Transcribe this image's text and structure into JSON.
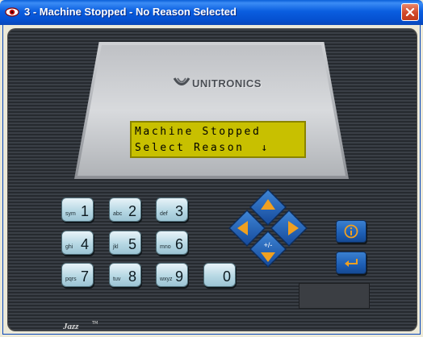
{
  "window": {
    "title": "3 - Machine Stopped - No Reason Selected",
    "icons": {
      "app": "eye-icon",
      "close": "close-icon"
    },
    "colors": {
      "titlebar": "#0a5ee0",
      "close_button": "#d0482a"
    }
  },
  "device": {
    "brand": "UNITRONICS",
    "model_logo": "Jazz",
    "model_logo_mark": "TM",
    "lcd": {
      "line1": "Machine Stopped",
      "line2": "Select Reason  ↓",
      "color": "#c8c000"
    },
    "keypad": {
      "keys": [
        {
          "label": "1",
          "sub": "sym"
        },
        {
          "label": "2",
          "sub": "abc"
        },
        {
          "label": "3",
          "sub": "def"
        },
        {
          "label": "4",
          "sub": "ghi"
        },
        {
          "label": "5",
          "sub": "jkl"
        },
        {
          "label": "6",
          "sub": "mno"
        },
        {
          "label": "7",
          "sub": "pqrs"
        },
        {
          "label": "8",
          "sub": "tuv"
        },
        {
          "label": "9",
          "sub": "wxyz"
        },
        {
          "label": "0",
          "sub": ""
        }
      ],
      "key_color": "#b7d8e4"
    },
    "nav": {
      "up": "arrow-up-icon",
      "down_label": "+/-",
      "left": "arrow-left-icon",
      "right": "arrow-right-icon",
      "arrow_color": "#f0a020",
      "pad_color": "#1d5db3"
    },
    "func_keys": {
      "info": "info-icon",
      "enter": "enter-icon"
    }
  }
}
